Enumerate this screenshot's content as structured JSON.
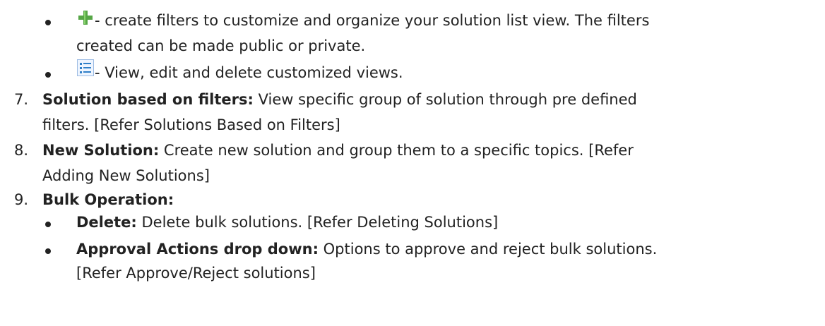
{
  "intro_bullets": [
    {
      "icon": "green-plus-icon",
      "lines": [
        "- create filters to customize and organize your solution list view. The filters",
        "created can be made public or private."
      ]
    },
    {
      "icon": "list-view-icon",
      "lines": [
        "- View, edit and delete customized views."
      ]
    }
  ],
  "items": [
    {
      "number": "7.",
      "title": "Solution based on filters:",
      "text_line1": " View specific group of solution through pre defined",
      "text_line2": "filters. [Refer Solutions Based on Filters]"
    },
    {
      "number": "8.",
      "title": "New Solution:",
      "text_line1": " Create new solution and group them to a specific topics. [Refer",
      "text_line2": "Adding New Solutions]"
    },
    {
      "number": "9.",
      "title": "Bulk Operation:",
      "sub_bullets": [
        {
          "title": "Delete:",
          "text_line1": " Delete bulk solutions. [Refer Deleting Solutions]"
        },
        {
          "title": "Approval Actions drop down:",
          "text_line1": " Options to approve and reject bulk solutions.",
          "text_line2": "[Refer Approve/Reject solutions]"
        }
      ]
    }
  ],
  "colors": {
    "text": "#222222",
    "plus_icon": "#56a646",
    "list_icon": "#2f7fc8"
  }
}
